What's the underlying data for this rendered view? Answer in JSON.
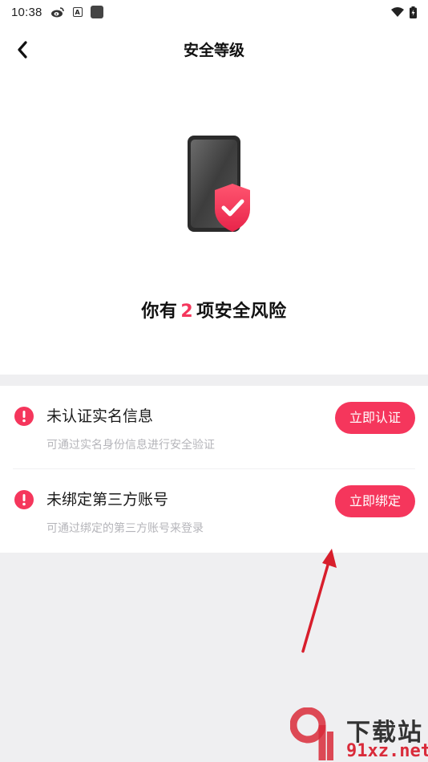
{
  "status_bar": {
    "time": "10:38",
    "icons": [
      "weibo-icon",
      "a-app-icon",
      "square-app-icon",
      "wifi-icon",
      "battery-icon"
    ]
  },
  "header": {
    "title": "安全等级",
    "back_icon": "chevron-left-icon"
  },
  "hero": {
    "illustration": "phone-shield-check-icon",
    "risk_prefix": "你有",
    "risk_count": "2",
    "risk_suffix": "项安全风险"
  },
  "risks": [
    {
      "title": "未认证实名信息",
      "description": "可通过实名身份信息进行安全验证",
      "button_label": "立即认证",
      "icon": "alert-circle-icon"
    },
    {
      "title": "未绑定第三方账号",
      "description": "可通过绑定的第三方账号来登录",
      "button_label": "立即绑定",
      "icon": "alert-circle-icon"
    }
  ],
  "watermark": {
    "top": "下载站",
    "bottom": "91xz.net"
  },
  "colors": {
    "accent": "#f5365c",
    "background": "#efeff1",
    "surface": "#ffffff",
    "secondary_text": "#b5b5ba"
  }
}
